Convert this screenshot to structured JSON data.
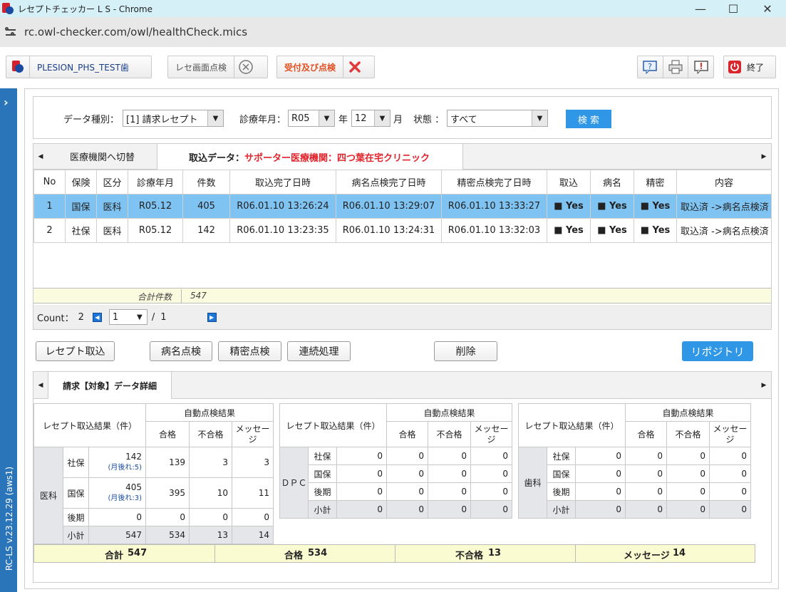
{
  "window": {
    "title": "レセプトチェッカー L S  - Chrome",
    "minimize": "—",
    "maximize": "☐",
    "close": "✕"
  },
  "browser": {
    "url": "rc.owl-checker.com/owl/healthCheck.mics"
  },
  "toolbar": {
    "user": "PLESION_PHS_TEST歯",
    "rese_check": "レセ画面点検",
    "uketsuke": "受付及び点検",
    "exit": "終了"
  },
  "sidebar": {
    "version": "RC-LS v.23.12.29 (aws1)"
  },
  "search": {
    "data_type_label": "データ種別：",
    "data_type_value": "[1] 請求レセプト",
    "month_label": "診療年月：",
    "era_value": "R05",
    "year_unit": "年",
    "month_value": "12",
    "month_unit": "月",
    "status_label": "状態 ：",
    "status_value": "すべて",
    "search_button": "検 索"
  },
  "upper": {
    "tab_switch": "医療機関へ切替",
    "import_label": "取込データ：",
    "import_value": "サポーター医療機関：四つ葉在宅クリニック",
    "columns": [
      "No",
      "保険",
      "区分",
      "診療年月",
      "件数",
      "取込完了日時",
      "病名点検完了日時",
      "精密点検完了日時",
      "取込",
      "病名",
      "精密",
      "内容"
    ],
    "rows": [
      {
        "no": "1",
        "hoken": "国保",
        "kubun": "医科",
        "ym": "R05.12",
        "count": "405",
        "import_dt": "R06.01.10 13:26:24",
        "byomei_dt": "R06.01.10 13:29:07",
        "seimitsu_dt": "R06.01.10 13:33:27",
        "torikomi": "■ Yes",
        "byomei": "■ Yes",
        "seimitsu": "■ Yes",
        "content": "取込済 ->病名点検済"
      },
      {
        "no": "2",
        "hoken": "社保",
        "kubun": "医科",
        "ym": "R05.12",
        "count": "142",
        "import_dt": "R06.01.10 13:23:35",
        "byomei_dt": "R06.01.10 13:24:31",
        "seimitsu_dt": "R06.01.10 13:32:03",
        "torikomi": "■ Yes",
        "byomei": "■ Yes",
        "seimitsu": "■ Yes",
        "content": "取込済 ->病名点検済"
      }
    ],
    "total_label": "合計件数",
    "total_value": "547",
    "count_label": "Count：",
    "count_value": "2",
    "page_value": "1",
    "page_sep": "/",
    "page_total": "1"
  },
  "actions": {
    "receipt_import": "レセプト取込",
    "byomei_check": "病名点検",
    "seimitsu_check": "精密点検",
    "renzoku": "連続処理",
    "delete": "削除",
    "repository": "リポジトリ"
  },
  "lower": {
    "tab": "請求【対象】データ詳細",
    "result_header": "レセプト取込結果（件）",
    "auto_header": "自動点検結果",
    "pass": "合格",
    "fail": "不合格",
    "message": "メッセージ",
    "ika": {
      "category": "医科",
      "rows": [
        {
          "label": "社保",
          "count": "142",
          "sub": "(月後れ:5)",
          "pass": "139",
          "fail": "3",
          "msg": "3"
        },
        {
          "label": "国保",
          "count": "405",
          "sub": "(月後れ:3)",
          "pass": "395",
          "fail": "10",
          "msg": "11"
        },
        {
          "label": "後期",
          "count": "0",
          "pass": "0",
          "fail": "0",
          "msg": "0"
        },
        {
          "label": "小計",
          "count": "547",
          "pass": "534",
          "fail": "13",
          "msg": "14"
        }
      ]
    },
    "dpc": {
      "category": "ＤＰＣ",
      "rows": [
        {
          "label": "社保",
          "count": "0",
          "pass": "0",
          "fail": "0",
          "msg": "0"
        },
        {
          "label": "国保",
          "count": "0",
          "pass": "0",
          "fail": "0",
          "msg": "0"
        },
        {
          "label": "後期",
          "count": "0",
          "pass": "0",
          "fail": "0",
          "msg": "0"
        },
        {
          "label": "小計",
          "count": "0",
          "pass": "0",
          "fail": "0",
          "msg": "0"
        }
      ]
    },
    "shika": {
      "category": "歯科",
      "rows": [
        {
          "label": "社保",
          "count": "0",
          "pass": "0",
          "fail": "0",
          "msg": "0"
        },
        {
          "label": "国保",
          "count": "0",
          "pass": "0",
          "fail": "0",
          "msg": "0"
        },
        {
          "label": "後期",
          "count": "0",
          "pass": "0",
          "fail": "0",
          "msg": "0"
        },
        {
          "label": "小計",
          "count": "0",
          "pass": "0",
          "fail": "0",
          "msg": "0"
        }
      ]
    },
    "totals": {
      "total_label": "合計",
      "total_value": "547",
      "pass_label": "合格",
      "pass_value": "534",
      "fail_label": "不合格",
      "fail_value": "13",
      "msg_label": "メッセージ",
      "msg_value": "14"
    }
  }
}
